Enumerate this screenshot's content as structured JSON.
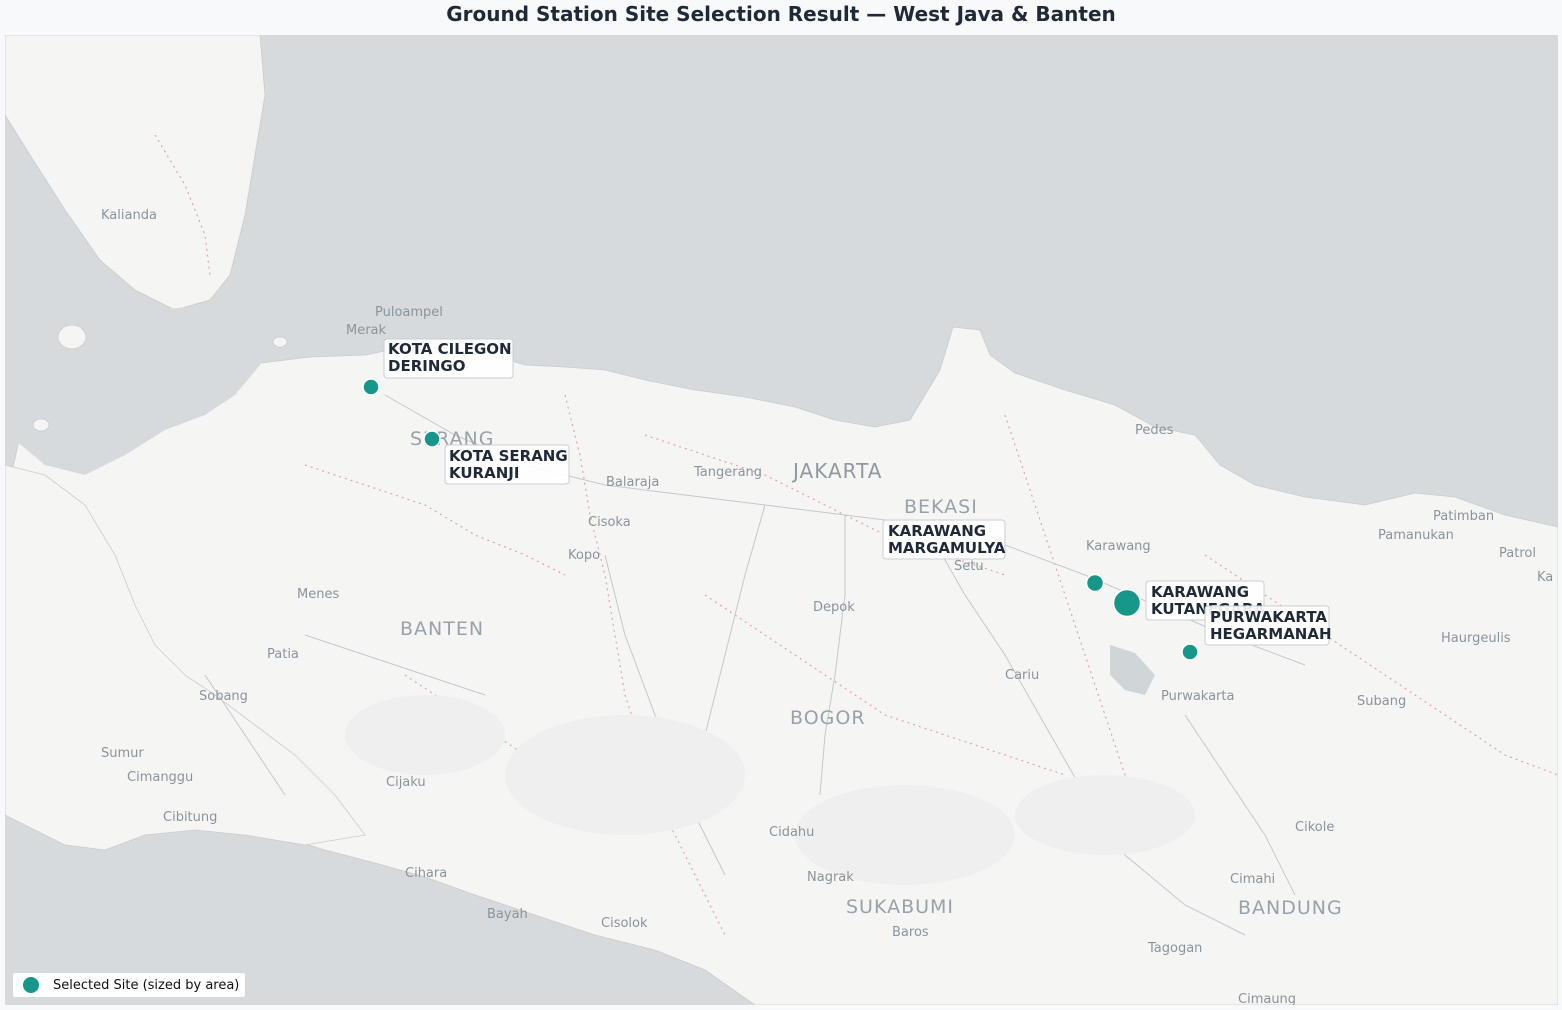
{
  "title": "Ground Station Site Selection Result — West Java & Banten",
  "colors": {
    "site": "#17968a",
    "sea": "#d6dadd",
    "land": "#f5f5f4",
    "boundary": "#e0a3a3"
  },
  "legend": {
    "label": "Selected Site (sized by area)",
    "marker_icon": "circle-marker-icon"
  },
  "places": [
    {
      "name": "Kalianda",
      "size": "small"
    },
    {
      "name": "Puloampel",
      "size": "small"
    },
    {
      "name": "Merak",
      "size": "small"
    },
    {
      "name": "SERANG",
      "size": "big"
    },
    {
      "name": "Balaraja",
      "size": "small"
    },
    {
      "name": "Tangerang",
      "size": "small"
    },
    {
      "name": "JAKARTA",
      "size": "big"
    },
    {
      "name": "BEKASI",
      "size": "big"
    },
    {
      "name": "Cisoka",
      "size": "small"
    },
    {
      "name": "Kopo",
      "size": "small"
    },
    {
      "name": "Menes",
      "size": "small"
    },
    {
      "name": "BANTEN",
      "size": "big"
    },
    {
      "name": "Patia",
      "size": "small"
    },
    {
      "name": "Sobang",
      "size": "small"
    },
    {
      "name": "Sumur",
      "size": "small"
    },
    {
      "name": "Cimanggu",
      "size": "small"
    },
    {
      "name": "Cijaku",
      "size": "small"
    },
    {
      "name": "Cibitung",
      "size": "small"
    },
    {
      "name": "Cihara",
      "size": "small"
    },
    {
      "name": "Bayah",
      "size": "small"
    },
    {
      "name": "Cisolok",
      "size": "small"
    },
    {
      "name": "Depok",
      "size": "small"
    },
    {
      "name": "BOGOR",
      "size": "big"
    },
    {
      "name": "Cidahu",
      "size": "small"
    },
    {
      "name": "Nagrak",
      "size": "small"
    },
    {
      "name": "SUKABUMI",
      "size": "big"
    },
    {
      "name": "Baros",
      "size": "small"
    },
    {
      "name": "Setu",
      "size": "small"
    },
    {
      "name": "Karawang",
      "size": "small"
    },
    {
      "name": "Pedes",
      "size": "small"
    },
    {
      "name": "Cariu",
      "size": "small"
    },
    {
      "name": "Purwakarta",
      "size": "small"
    },
    {
      "name": "Patimban",
      "size": "small"
    },
    {
      "name": "Pamanukan",
      "size": "small"
    },
    {
      "name": "Patrol",
      "size": "small"
    },
    {
      "name": "Ka",
      "size": "small"
    },
    {
      "name": "Haurgeulis",
      "size": "small"
    },
    {
      "name": "Subang",
      "size": "small"
    },
    {
      "name": "Cikole",
      "size": "small"
    },
    {
      "name": "Cimahi",
      "size": "small"
    },
    {
      "name": "BANDUNG",
      "size": "big"
    },
    {
      "name": "Tagogan",
      "size": "small"
    },
    {
      "name": "Cimaung",
      "size": "small"
    }
  ],
  "sites": [
    {
      "line1": "KOTA CILEGON",
      "line2": "DERINGO"
    },
    {
      "line1": "KOTA SERANG",
      "line2": "KURANJI"
    },
    {
      "line1": "KARAWANG",
      "line2": "MARGAMULYA"
    },
    {
      "line1": "KARAWANG",
      "line2": "KUTANEGARA"
    },
    {
      "line1": "PURWAKARTA",
      "line2": "HEGARMANAH"
    }
  ]
}
